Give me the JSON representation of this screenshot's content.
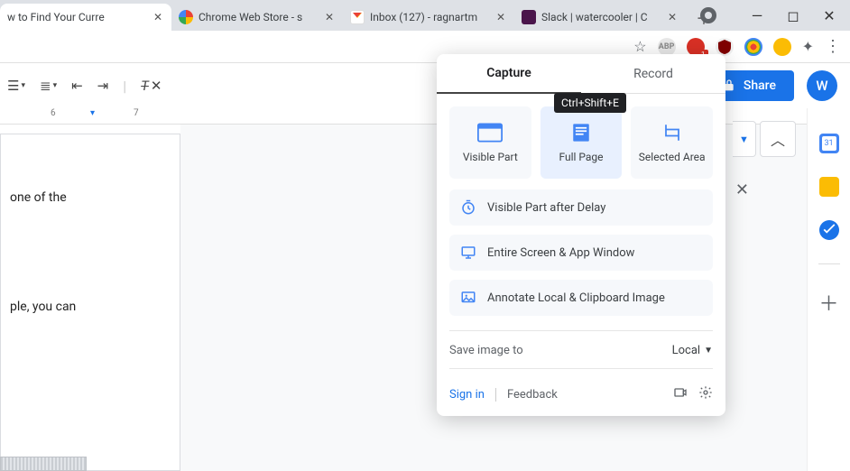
{
  "tabs": [
    {
      "title": "w to Find Your Curre",
      "favicon": "#ffffff"
    },
    {
      "title": "Chrome Web Store - s",
      "favicon": "linear-gradient(135deg,#4285f4,#ea4335,#fbbc04,#34a853)"
    },
    {
      "title": "Inbox (127) - ragnartm",
      "favicon": "#ea4335"
    },
    {
      "title": "Slack | watercooler | C",
      "favicon": "#4a154b"
    }
  ],
  "extensions": {
    "abp": "ABP"
  },
  "share": {
    "label": "Share",
    "avatar": "W"
  },
  "ruler": {
    "n6": "6",
    "n7": "7"
  },
  "doc": {
    "line1": "one of the",
    "line2": "ple, you can"
  },
  "sidebar": {
    "cal": "31"
  },
  "popup": {
    "tabs": {
      "capture": "Capture",
      "record": "Record"
    },
    "tooltip": "Ctrl+Shift+E",
    "cards": {
      "visible": "Visible Part",
      "full": "Full Page",
      "selected": "Selected Area"
    },
    "rows": {
      "delay": "Visible Part after Delay",
      "screen": "Entire Screen & App Window",
      "annotate": "Annotate Local & Clipboard Image"
    },
    "saveto_label": "Save image to",
    "saveto_dest": "Local",
    "signin": "Sign in",
    "feedback": "Feedback"
  }
}
